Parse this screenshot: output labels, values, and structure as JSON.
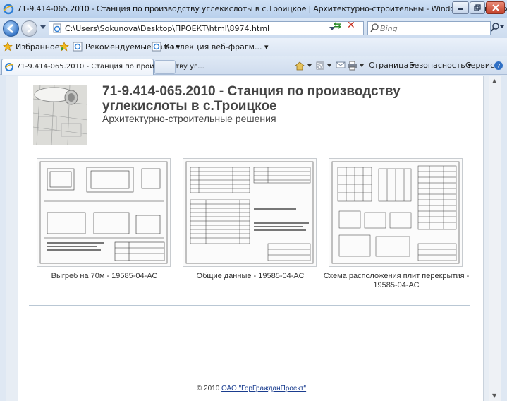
{
  "window": {
    "title": "71-9.414-065.2010 - Станция по производству углекислоты в с.Троицкое | Архитектурно-строительны - Windows Internet Explorer"
  },
  "address_bar": {
    "url": "C:\\Users\\Sokunova\\Desktop\\ПРОЕКТ\\html\\8974.html",
    "search_placeholder": "Bing"
  },
  "favorites_bar": {
    "favorites_label": "Избранное",
    "items": [
      "Рекомендуемые узлы ▾",
      "Коллекция веб-фрагм... ▾"
    ]
  },
  "tab": {
    "label": "71-9.414-065.2010 - Станция по производству уг..."
  },
  "command_bar": {
    "page_label": "Страница ▾",
    "safety_label": "Безопасность ▾",
    "tools_label": "Сервис ▾"
  },
  "page": {
    "title": "71-9.414-065.2010 - Станция по производству углекислоты в с.Троицкое",
    "subtitle": "Архитектурно-строительные решения",
    "thumbnails": [
      {
        "caption": "Выгреб на 70м - 19585-04-АС"
      },
      {
        "caption": "Общие данные - 19585-04-АС"
      },
      {
        "caption": "Схема расположения плит перекрытия - 19585-04-АС"
      }
    ],
    "footer": {
      "prefix": "© 2010 ",
      "link": "ОАО \"ГорГражданПроект\""
    }
  }
}
